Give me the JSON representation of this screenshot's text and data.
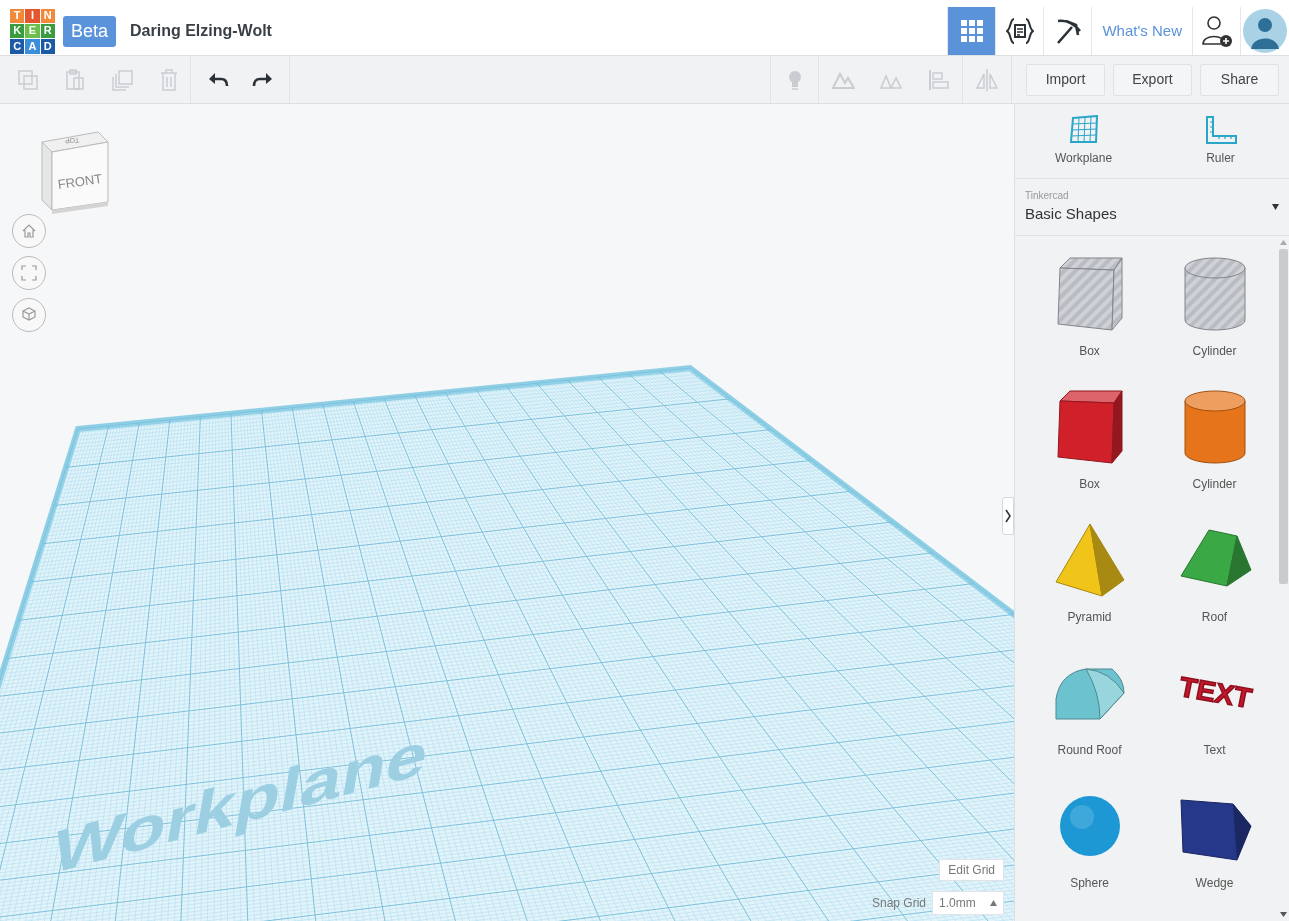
{
  "logo": {
    "letters": [
      "T",
      "I",
      "N",
      "K",
      "E",
      "R",
      "C",
      "A",
      "D"
    ]
  },
  "header": {
    "badge": "Beta",
    "design_name": "Daring Elzing-Wolt",
    "view_tabs": [
      {
        "kind": "grid",
        "selected": true
      },
      {
        "kind": "code-blocks",
        "selected": false
      },
      {
        "kind": "pickaxe",
        "selected": false
      }
    ],
    "link": "What's New"
  },
  "toolbar": {
    "edit_tools": [
      {
        "kind": "copy",
        "disabled": true
      },
      {
        "kind": "paste",
        "disabled": true
      },
      {
        "kind": "duplicate",
        "disabled": true
      },
      {
        "kind": "delete",
        "disabled": true
      }
    ],
    "history": [
      {
        "kind": "undo",
        "disabled": false
      },
      {
        "kind": "redo",
        "disabled": false
      }
    ],
    "shape_tools": [
      {
        "kind": "bulb",
        "disabled": true
      },
      {
        "kind": "group",
        "disabled": true
      },
      {
        "kind": "ungroup",
        "disabled": true
      },
      {
        "kind": "align",
        "disabled": true
      },
      {
        "kind": "mirror",
        "disabled": true
      }
    ],
    "buttons": [
      "Import",
      "Export",
      "Share"
    ]
  },
  "view_cube": {
    "top": "TOP",
    "front": "FRONT"
  },
  "workplane": {
    "label": "Workplane"
  },
  "grid_controls": {
    "edit_button": "Edit Grid",
    "snap_label": "Snap Grid",
    "snap_value": "1.0mm"
  },
  "sidebar": {
    "tools": [
      {
        "kind": "workplane",
        "label": "Workplane"
      },
      {
        "kind": "ruler",
        "label": "Ruler"
      }
    ],
    "library": {
      "caption": "Tinkercad",
      "value": "Basic Shapes"
    },
    "shapes": [
      {
        "kind": "box",
        "hole": true,
        "color": "#b9bdc3",
        "label": "Box"
      },
      {
        "kind": "cylinder",
        "hole": true,
        "color": "#b9bdc3",
        "label": "Cylinder"
      },
      {
        "kind": "box",
        "hole": false,
        "color": "#d0212b",
        "label": "Box"
      },
      {
        "kind": "cylinder",
        "hole": false,
        "color": "#e6741a",
        "label": "Cylinder"
      },
      {
        "kind": "pyramid",
        "hole": false,
        "color": "#f0c419",
        "label": "Pyramid"
      },
      {
        "kind": "roof",
        "hole": false,
        "color": "#3aa845",
        "label": "Roof"
      },
      {
        "kind": "round-roof",
        "hole": false,
        "color": "#6cc3cf",
        "label": "Round Roof"
      },
      {
        "kind": "text",
        "hole": false,
        "color": "#c8162b",
        "label": "Text",
        "glyph_text": "TEXT"
      },
      {
        "kind": "sphere",
        "hole": false,
        "color": "#1d98d4",
        "label": "Sphere"
      },
      {
        "kind": "wedge",
        "hole": false,
        "color": "#25388a",
        "label": "Wedge"
      }
    ]
  }
}
